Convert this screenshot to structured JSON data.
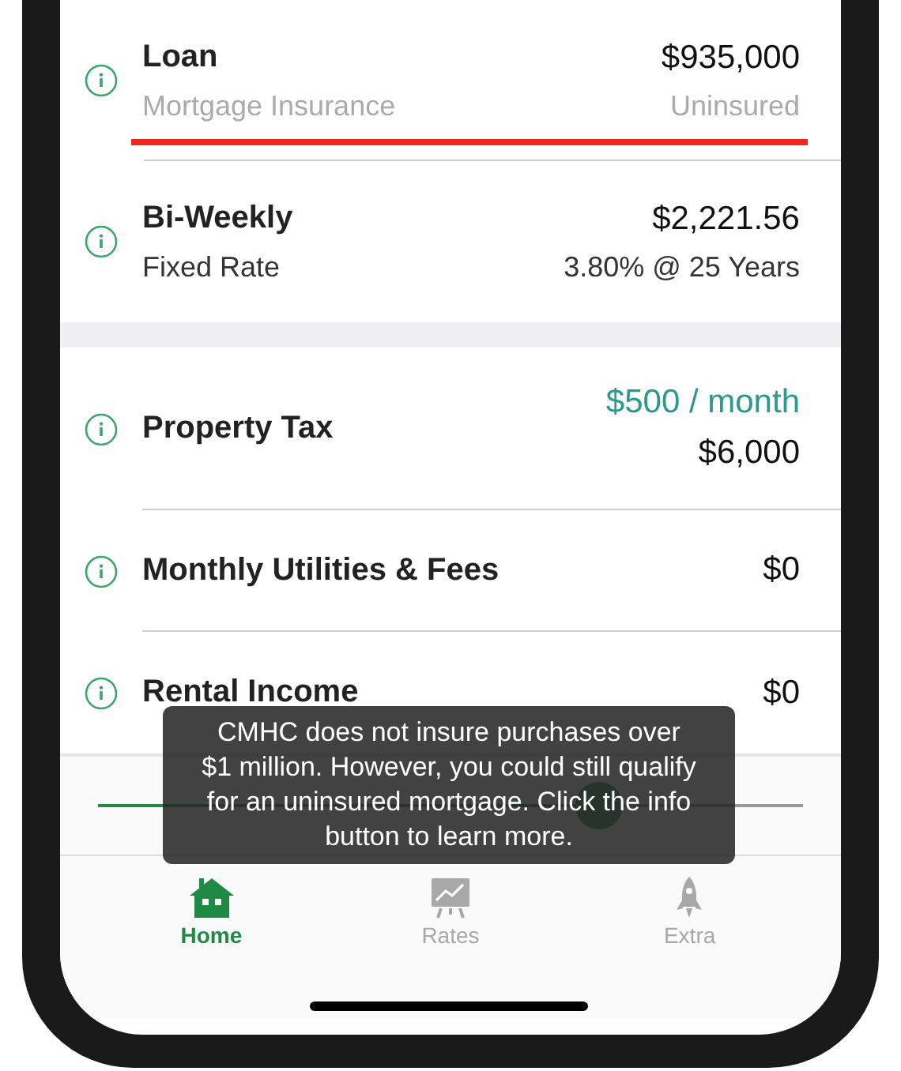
{
  "summary": [
    {
      "title": "Loan",
      "subtitle": "Mortgage Insurance",
      "value": "$935,000",
      "detail": "Uninsured",
      "muted": true,
      "flagged": true
    },
    {
      "title": "Bi-Weekly",
      "subtitle": "Fixed Rate",
      "value": "$2,221.56",
      "detail": "3.80% @ 25 Years",
      "muted": false,
      "flagged": false
    }
  ],
  "expenses": [
    {
      "title": "Property Tax",
      "monthly": "$500 / month",
      "amount": "$6,000"
    },
    {
      "title": "Monthly Utilities & Fees",
      "amount": "$0"
    },
    {
      "title": "Rental Income",
      "amount": "$0"
    }
  ],
  "slider": {
    "level": 0.71
  },
  "tooltip": {
    "text": "CMHC does not insure purchases over $1 million. However, you could still qualify for an uninsured mortgage. Click the info button to learn more."
  },
  "tabs": [
    {
      "label": "Home",
      "selected": true
    },
    {
      "label": "Rates",
      "selected": false
    },
    {
      "label": "Extra",
      "selected": false
    }
  ]
}
